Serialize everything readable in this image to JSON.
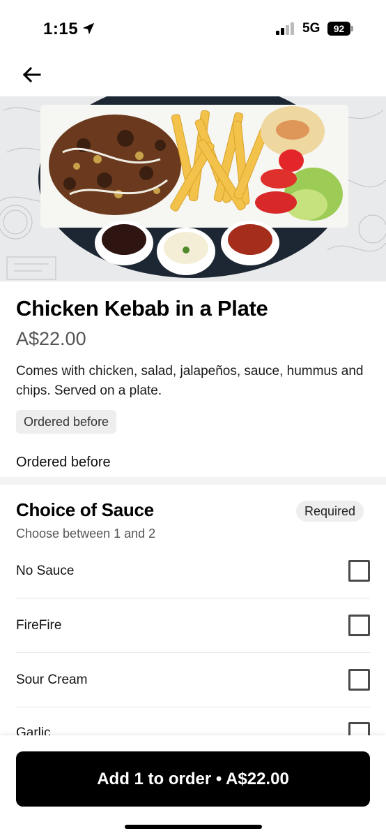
{
  "status_bar": {
    "time": "1:15",
    "network": "5G",
    "battery": "92"
  },
  "item": {
    "title": "Chicken Kebab in a Plate",
    "price": "A$22.00",
    "description": "Comes with chicken, salad, jalapeños, sauce, hummus and chips. Served on a plate.",
    "ordered_badge": "Ordered before",
    "ordered_text": "Ordered before"
  },
  "sauce_section": {
    "title": "Choice of Sauce",
    "required_label": "Required",
    "subtitle": "Choose between 1 and 2",
    "options": [
      {
        "label": "No Sauce",
        "checked": false
      },
      {
        "label": "FireFire",
        "checked": false
      },
      {
        "label": "Sour Cream",
        "checked": false
      },
      {
        "label": "Garlic",
        "checked": false
      }
    ]
  },
  "cta": {
    "label": "Add 1 to order • A$22.00"
  },
  "icons": {
    "back": "arrow-left-icon",
    "location": "location-arrow-icon",
    "signal": "cellular-signal-icon",
    "battery": "battery-icon"
  },
  "colors": {
    "primary_button": "#000000",
    "badge_bg": "#eeeeee",
    "price_text": "#545454"
  }
}
